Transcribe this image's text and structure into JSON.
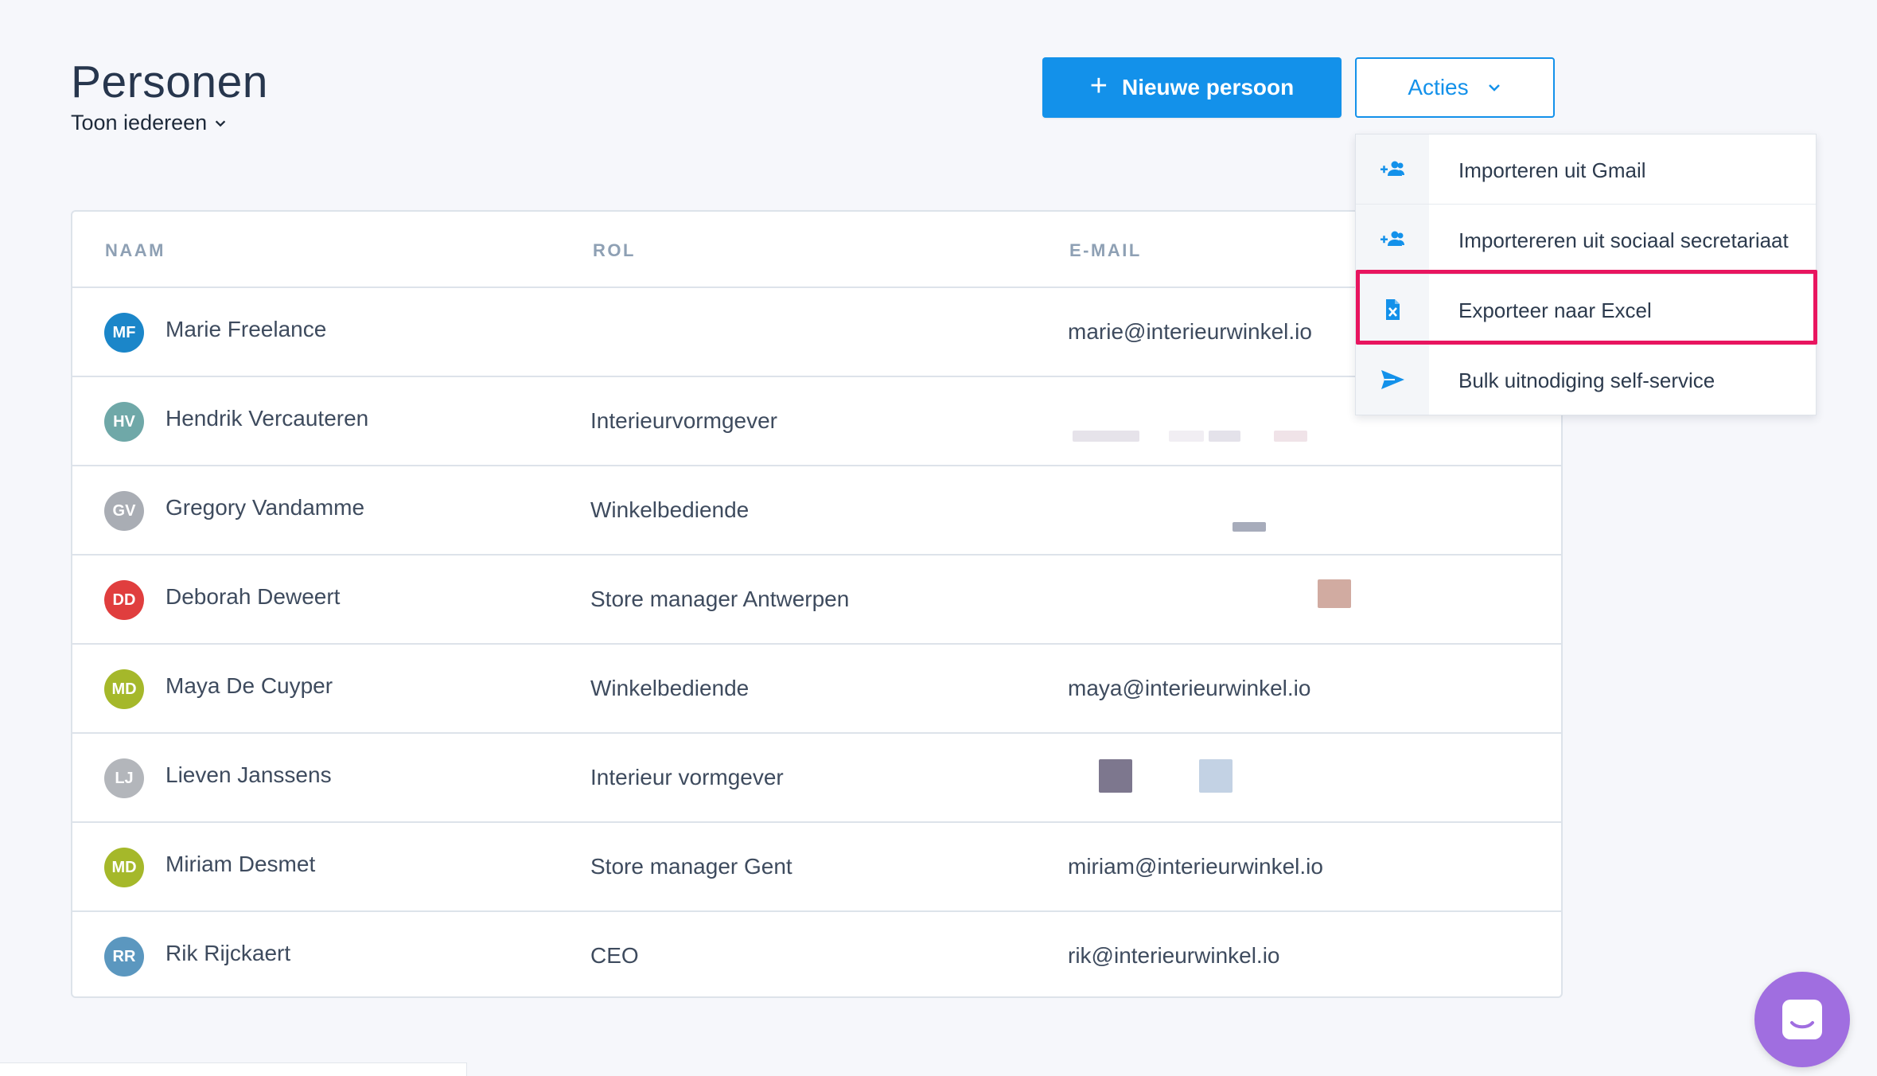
{
  "header": {
    "title": "Personen",
    "filter_label": "Toon iedereen",
    "new_person_label": "Nieuwe persoon",
    "actions_label": "Acties"
  },
  "table": {
    "columns": [
      "NAAM",
      "ROL",
      "E-MAIL"
    ],
    "rows": [
      {
        "initials": "MF",
        "name": "Marie Freelance",
        "role": "",
        "email": "marie@interieurwinkel.io",
        "avatar_color": "#1b86c9"
      },
      {
        "initials": "HV",
        "name": "Hendrik Vercauteren",
        "role": "Interieurvormgever",
        "email": "",
        "avatar_color": "#6fa8a8"
      },
      {
        "initials": "GV",
        "name": "Gregory Vandamme",
        "role": "Winkelbediende",
        "email": "",
        "avatar_color": "#a9adb4"
      },
      {
        "initials": "DD",
        "name": "Deborah Deweert",
        "role": "Store manager Antwerpen",
        "email": "",
        "avatar_color": "#e03e3e"
      },
      {
        "initials": "MD",
        "name": "Maya De Cuyper",
        "role": "Winkelbediende",
        "email": "maya@interieurwinkel.io",
        "avatar_color": "#a5b82a"
      },
      {
        "initials": "LJ",
        "name": "Lieven Janssens",
        "role": "Interieur vormgever",
        "email": "",
        "avatar_color": "#b3b6bb"
      },
      {
        "initials": "MD",
        "name": "Miriam Desmet",
        "role": "Store manager Gent",
        "email": "miriam@interieurwinkel.io",
        "avatar_color": "#a5b82a"
      },
      {
        "initials": "RR",
        "name": "Rik Rijckaert",
        "role": "CEO",
        "email": "rik@interieurwinkel.io",
        "avatar_color": "#5b97bf"
      }
    ]
  },
  "actions_menu": {
    "items": [
      {
        "label": "Importeren uit Gmail",
        "icon": "add-people-icon"
      },
      {
        "label": "Importereren uit sociaal secretariaat",
        "icon": "add-people-icon"
      },
      {
        "label": "Exporteer naar Excel",
        "icon": "excel-file-icon",
        "highlighted": true
      },
      {
        "label": "Bulk uitnodiging self-service",
        "icon": "send-icon"
      }
    ]
  },
  "colors": {
    "primary": "#1391ea",
    "highlight": "#e8155f",
    "chat": "#a06ee0"
  }
}
